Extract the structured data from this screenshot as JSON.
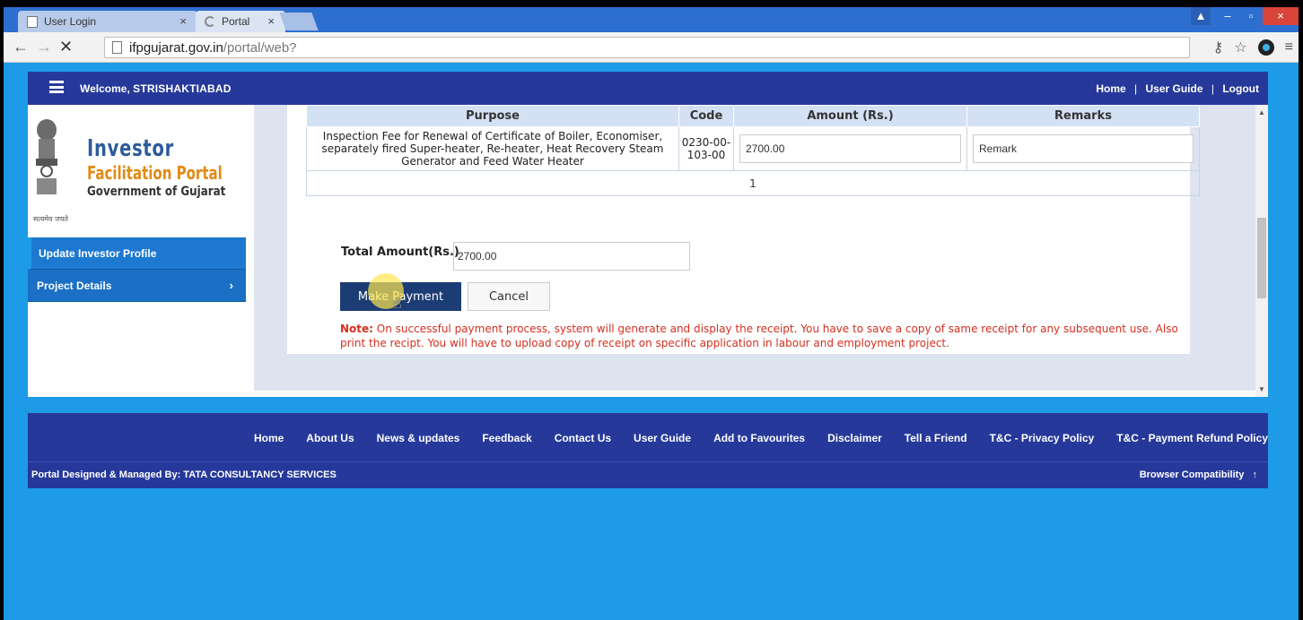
{
  "browser": {
    "tabs": [
      {
        "title": "User Login",
        "state": "inactive"
      },
      {
        "title": "Portal",
        "state": "loading"
      }
    ],
    "url_host": "ifpgujarat.gov.in",
    "url_path": "/portal/web?"
  },
  "header": {
    "welcome_label": "Welcome,",
    "username": "STRISHAKTIABAD",
    "links": [
      "Home",
      "User Guide",
      "Logout"
    ],
    "separator": "|"
  },
  "logo": {
    "line1": "Investor",
    "line2": "Facilitation Portal",
    "line3": "Government of Gujarat",
    "motto": "सत्यमेव जयते"
  },
  "sidebar": {
    "items": [
      {
        "label": "Update Investor Profile"
      },
      {
        "label": "Project Details",
        "chevron": "›"
      }
    ]
  },
  "fee_table": {
    "headers": [
      "Purpose",
      "Code",
      "Amount (Rs.)",
      "Remarks"
    ],
    "row": {
      "purpose": "Inspection Fee for Renewal of Certificate of Boiler, Economiser, separately fired Super-heater, Re-heater, Heat Recovery Steam Generator and Feed Water Heater",
      "code": "0230-00-103-00",
      "amount": "2700.00",
      "remarks": "Remark"
    },
    "page": "1"
  },
  "payment": {
    "total_label": "Total Amount(Rs.)",
    "total_value": "2700.00",
    "pay_button": "Make Payment",
    "cancel_button": "Cancel",
    "note_label": "Note:",
    "note_text": "On successful payment process, system will generate and display the receipt. You have to save a copy of same receipt for any subsequent use. Also print the recipt. You will have to upload copy of receipt on specific application in labour and employment project."
  },
  "footer": {
    "links": [
      "Home",
      "About Us",
      "News & updates",
      "Feedback",
      "Contact Us",
      "User Guide",
      "Add to Favourites",
      "Disclaimer",
      "Tell a Friend",
      "T&C - Privacy Policy",
      "T&C - Payment Refund Policy"
    ],
    "credit": "Portal Designed & Managed By: TATA CONSULTANCY SERVICES",
    "compat": "Browser Compatibility",
    "compat_icon": "↑"
  },
  "colors": {
    "header_bg": "#26399a",
    "sidebar_bg": "#1b70c5",
    "page_bg": "#1e9be6",
    "note_red": "#d62f1f",
    "pay_button_bg": "#1c3c75"
  }
}
